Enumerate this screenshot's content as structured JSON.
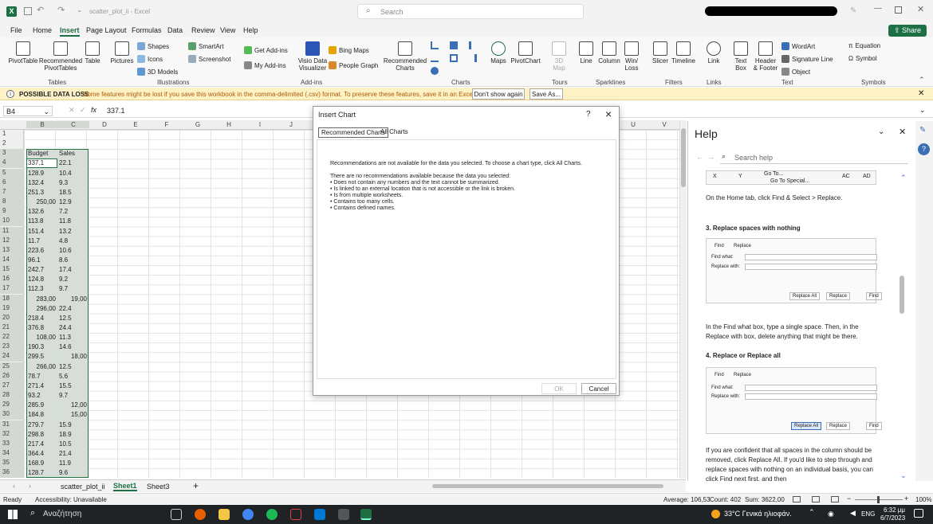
{
  "titlebar": {
    "doc_title": "scatter_plot_ii - Excel",
    "search_placeholder": "Search",
    "share_label": "Share"
  },
  "menu": [
    "File",
    "Home",
    "Insert",
    "Page Layout",
    "Formulas",
    "Data",
    "Review",
    "View",
    "Help"
  ],
  "ribbon": {
    "pivot_table": "PivotTable",
    "rec_pivot": "Recommended PivotTables",
    "table": "Table",
    "pictures": "Pictures",
    "shapes": "Shapes",
    "icons": "Icons",
    "models3d": "3D Models",
    "smartart": "SmartArt",
    "screenshot": "Screenshot",
    "get_addins": "Get Add-ins",
    "my_addins": "My Add-ins",
    "visio": "Visio Data Visualizer",
    "bing_maps": "Bing Maps",
    "people_graph": "People Graph",
    "rec_charts": "Recommended Charts",
    "maps": "Maps",
    "pivot_chart": "PivotChart",
    "map3d": "3D Map",
    "line": "Line",
    "column": "Column",
    "winloss": "Win/ Loss",
    "slicer": "Slicer",
    "timeline": "Timeline",
    "link": "Link",
    "textbox": "Text Box",
    "header_footer": "Header & Footer",
    "wordart": "WordArt",
    "signature": "Signature Line",
    "object": "Object",
    "equation": "Equation",
    "symbol": "Symbol",
    "groups": {
      "tables": "Tables",
      "illustrations": "Illustrations",
      "addins": "Add-ins",
      "charts": "Charts",
      "tours": "Tours",
      "sparklines": "Sparklines",
      "filters": "Filters",
      "links": "Links",
      "text": "Text",
      "symbols": "Symbols"
    }
  },
  "infobar": {
    "title": "POSSIBLE DATA LOSS",
    "message": "Some features might be lost if you save this workbook in the comma-delimited (.csv) format. To preserve these features, save it in an Excel file format.",
    "dont_show": "Don't show again",
    "save_as": "Save As..."
  },
  "formula": {
    "name_box": "B4",
    "fx": "fx",
    "value": "337.1"
  },
  "columns": [
    "B",
    "C",
    "D",
    "E",
    "F",
    "G",
    "H",
    "I",
    "J",
    "U",
    "V"
  ],
  "rows": [
    "1",
    "2",
    "3",
    "4",
    "5",
    "6",
    "7",
    "8",
    "9",
    "10",
    "11",
    "12",
    "13",
    "14",
    "15",
    "16",
    "17",
    "18",
    "19",
    "20",
    "21",
    "22",
    "23",
    "24",
    "25",
    "26",
    "27",
    "28",
    "29",
    "30",
    "31",
    "32",
    "33",
    "34",
    "35",
    "36"
  ],
  "sheet": {
    "header_b": "Budget",
    "header_c": "Sales",
    "b": [
      "337.1",
      "128.9",
      "132.4",
      "251.3",
      "250,00",
      "132.6",
      "113.8",
      "151.4",
      "11.7",
      "223.6",
      "96.1",
      "242.7",
      "124.8",
      "112.3",
      "283,00",
      "296,00",
      "218.4",
      "376.8",
      "108,00",
      "190.3",
      "299.5",
      "266,00",
      "78.7",
      "271.4",
      "93.2",
      "285.9",
      "184.8",
      "279.7",
      "298.8",
      "217.4",
      "364.4",
      "168.9",
      "128.7"
    ],
    "c": [
      "22.1",
      "10.4",
      "9.3",
      "18.5",
      "12.9",
      "7.2",
      "11.8",
      "13.2",
      "4.8",
      "10.6",
      "8.6",
      "17.4",
      "9.2",
      "9.7",
      "19,00",
      "22.4",
      "12.5",
      "24.4",
      "11.3",
      "14.6",
      "18,00",
      "12.5",
      "5.6",
      "15.5",
      "9.7",
      "12,00",
      "15,00",
      "15.9",
      "18.9",
      "10.5",
      "21.4",
      "11.9",
      "9.6"
    ]
  },
  "dialog": {
    "title": "Insert Chart",
    "help": "?",
    "close": "×",
    "tab_recommended": "Recommended Charts",
    "tab_all": "All Charts",
    "line1": "Recommendations are not available for the data you selected. To choose a chart type, click All Charts.",
    "line2": "There are no recommendations available because the data you selected:",
    "bullets": [
      "• Does not contain any numbers and the text cannot be summarized.",
      "• Is linked to an external location that is not accessible or the link is broken.",
      "• Is from multiple worksheets.",
      "• Contains too many cells.",
      "• Contains defined names."
    ],
    "ok": "OK",
    "cancel": "Cancel"
  },
  "help": {
    "title": "Help",
    "search_placeholder": "Search help",
    "step_intro": "On the Home tab, click Find & Select > Replace.",
    "step3": "3. Replace spaces with nothing",
    "find": "Find",
    "replace": "Replace",
    "find_what": "Find what:",
    "replace_with": "Replace with:",
    "replace_all": "Replace All",
    "find_next": "Find",
    "para1": "In the Find what box, type a single space. Then, in the Replace with box, delete anything that might be there.",
    "step4": "4. Replace or Replace all",
    "para2": "If you are confident that all spaces in the column should be removed, click Replace All. If you'd like to step through and replace spaces with nothing on an individual basis, you can click Find next first, and then",
    "img_cols": [
      "X",
      "Y",
      "AC",
      "AD"
    ],
    "img_menu": [
      "Go To...",
      "Go To Special..."
    ]
  },
  "sheets": {
    "tab1": "scatter_plot_ii",
    "tab2": "Sheet1",
    "tab3": "Sheet3",
    "add": "+"
  },
  "status": {
    "ready": "Ready",
    "accessibility": "Accessibility: Unavailable",
    "average": "Average: 106,53",
    "count": "Count: 402",
    "sum": "Sum: 3622,00",
    "zoom": "100%"
  },
  "taskbar": {
    "search": "Αναζήτηση",
    "weather": "33°C Γενικά ηλιοφάν.",
    "lang": "ENG",
    "time": "6:32 μμ",
    "date": "6/7/2023"
  }
}
